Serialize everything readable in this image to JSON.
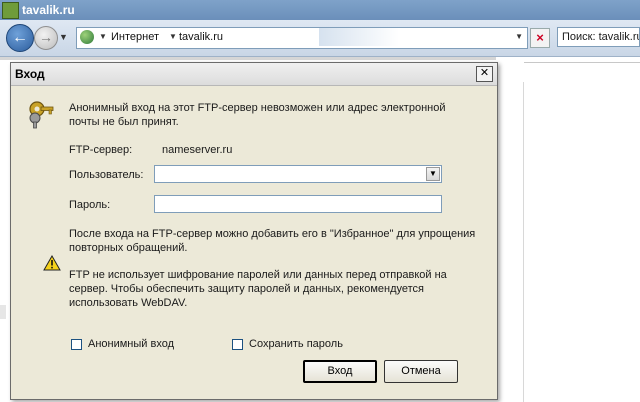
{
  "browser": {
    "window_title": "tavalik.ru",
    "address": {
      "crumbs": [
        "Интернет",
        "tavalik.ru"
      ]
    },
    "search": {
      "value": "Поиск: tavalik.ru"
    }
  },
  "dialog": {
    "title": "Вход",
    "close_label": "✕",
    "message": "Анонимный вход на этот FTP-сервер невозможен или адрес электронной почты не был принят.",
    "server_label": "FTP-сервер:",
    "server_value": "nameserver.ru",
    "user_label": "Пользователь:",
    "user_value": "",
    "password_label": "Пароль:",
    "password_value": "",
    "favorites_note": "После входа на FTP-сервер можно добавить его в \"Избранное\" для упрощения повторных обращений.",
    "warning": "FTP не использует шифрование паролей или данных перед отправкой на сервер. Чтобы обеспечить защиту паролей и данных, рекомендуется использовать WebDAV.",
    "anonymous_label": "Анонимный вход",
    "save_password_label": "Сохранить пароль",
    "login_button": "Вход",
    "cancel_button": "Отмена"
  },
  "icons": {
    "back": "back-arrow-icon",
    "forward": "forward-arrow-icon",
    "site": "globe-icon",
    "stop": "stop-icon",
    "keys": "key-icon",
    "warning": "warning-icon"
  }
}
